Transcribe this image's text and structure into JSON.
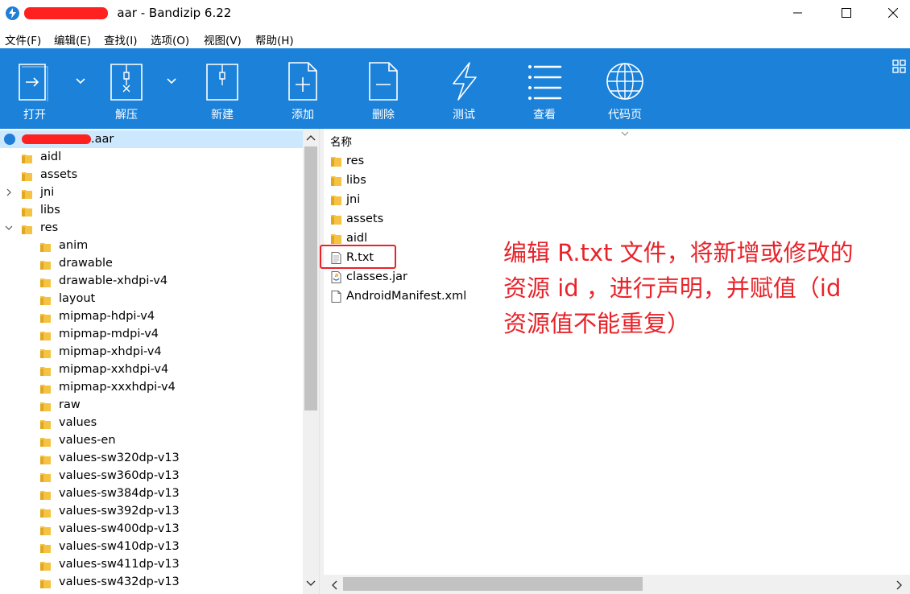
{
  "window": {
    "title_suffix": "aar - Bandizip 6.22"
  },
  "menu": [
    {
      "label": "文件(F)"
    },
    {
      "label": "编辑(E)"
    },
    {
      "label": "查找(I)"
    },
    {
      "label": "选项(O)"
    },
    {
      "label": "视图(V)"
    },
    {
      "label": "帮助(H)"
    }
  ],
  "toolbar": {
    "open": "打开",
    "extract": "解压",
    "new": "新建",
    "add": "添加",
    "delete": "删除",
    "test": "测试",
    "view": "查看",
    "codepage": "代码页"
  },
  "tree": {
    "root_suffix": ".aar",
    "items": [
      {
        "label": "aidl"
      },
      {
        "label": "assets"
      },
      {
        "label": "jni"
      },
      {
        "label": "libs"
      },
      {
        "label": "res"
      },
      {
        "label": "anim"
      },
      {
        "label": "drawable"
      },
      {
        "label": "drawable-xhdpi-v4"
      },
      {
        "label": "layout"
      },
      {
        "label": "mipmap-hdpi-v4"
      },
      {
        "label": "mipmap-mdpi-v4"
      },
      {
        "label": "mipmap-xhdpi-v4"
      },
      {
        "label": "mipmap-xxhdpi-v4"
      },
      {
        "label": "mipmap-xxxhdpi-v4"
      },
      {
        "label": "raw"
      },
      {
        "label": "values"
      },
      {
        "label": "values-en"
      },
      {
        "label": "values-sw320dp-v13"
      },
      {
        "label": "values-sw360dp-v13"
      },
      {
        "label": "values-sw384dp-v13"
      },
      {
        "label": "values-sw392dp-v13"
      },
      {
        "label": "values-sw400dp-v13"
      },
      {
        "label": "values-sw410dp-v13"
      },
      {
        "label": "values-sw411dp-v13"
      },
      {
        "label": "values-sw432dp-v13"
      }
    ]
  },
  "list": {
    "column_name": "名称",
    "items": [
      {
        "label": "res",
        "icon": "folder-icon"
      },
      {
        "label": "libs",
        "icon": "folder-icon"
      },
      {
        "label": "jni",
        "icon": "folder-icon"
      },
      {
        "label": "assets",
        "icon": "folder-icon"
      },
      {
        "label": "aidl",
        "icon": "folder-icon"
      },
      {
        "label": "R.txt",
        "icon": "text-file-icon"
      },
      {
        "label": "classes.jar",
        "icon": "jar-file-icon"
      },
      {
        "label": "AndroidManifest.xml",
        "icon": "file-icon"
      }
    ]
  },
  "annotation": {
    "line1": "编辑 R.txt 文件，将新增或修改的",
    "line2": "资源 id ，进行声明，并赋值（id",
    "line3": "资源值不能重复）"
  },
  "colors": {
    "toolbar": "#1c82d9",
    "annotation": "#e8232a",
    "selection": "#cce8ff",
    "folder": "#f5c242"
  }
}
